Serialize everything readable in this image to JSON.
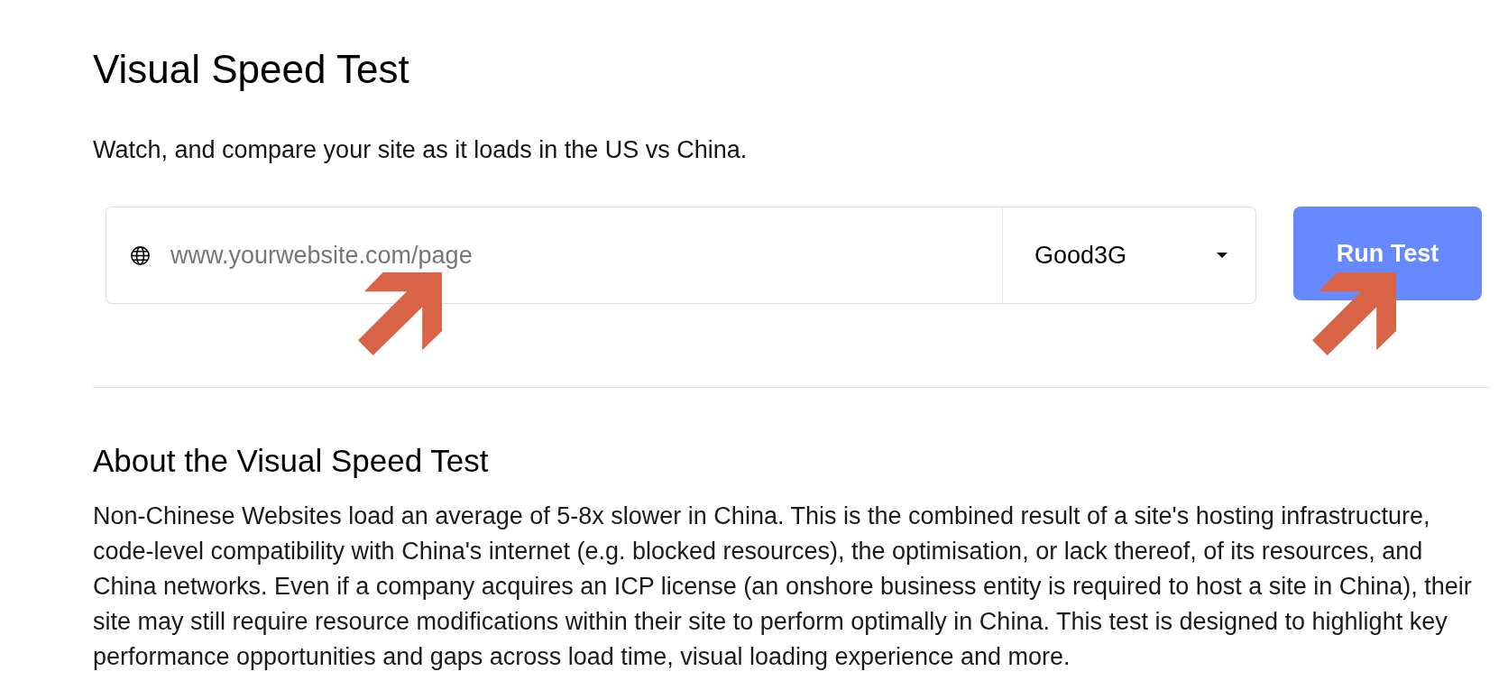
{
  "header": {
    "title": "Visual Speed Test",
    "subtitle": "Watch, and compare your site as it loads in the US vs China."
  },
  "test_form": {
    "url_field": {
      "placeholder": "www.yourwebsite.com/page"
    },
    "connection_select": {
      "value": "Good3G"
    },
    "run_button": {
      "label": "Run Test"
    }
  },
  "about": {
    "heading": "About the Visual Speed Test",
    "body": "Non-Chinese Websites load an average of 5-8x slower in China. This is the combined result of a site's hosting infrastructure, code-level compatibility with China's internet (e.g. blocked resources), the optimisation, or lack thereof, of its resources, and China networks. Even if a company acquires an ICP license (an onshore business entity is required to host a site in China), their site may still require resource modifications within their site to perform optimally in China. This test is designed to highlight key performance opportunities and gaps across load time, visual loading experience and more."
  }
}
